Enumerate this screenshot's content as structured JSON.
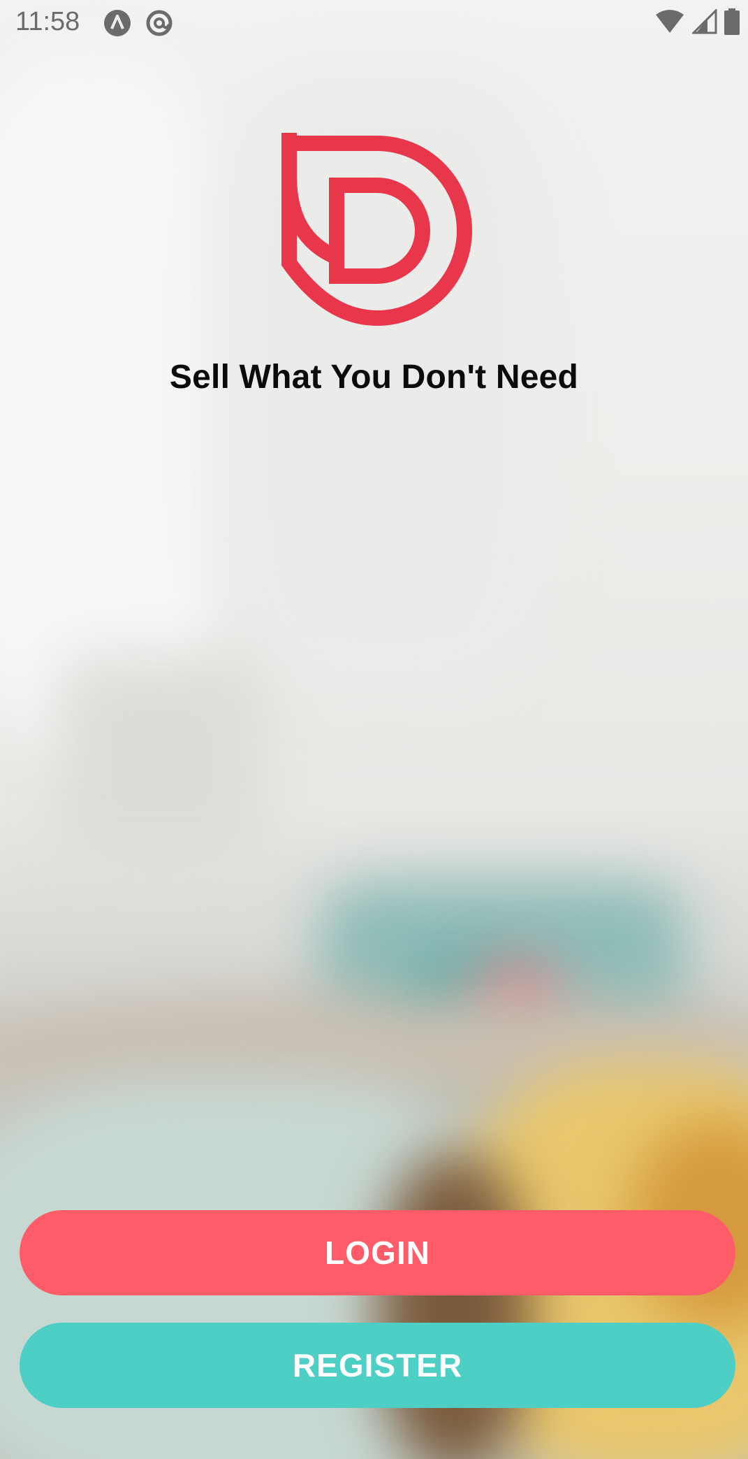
{
  "status_bar": {
    "time": "11:58",
    "icons": [
      "a-circle-icon",
      "at-circle-icon",
      "wifi-icon",
      "signal-icon",
      "battery-icon"
    ]
  },
  "logo": {
    "icon": "d-logo-icon",
    "color": "#e8364a"
  },
  "tagline": "Sell What You Don't Need",
  "buttons": {
    "login_label": "LOGIN",
    "register_label": "REGISTER",
    "login_color": "#fd5c68",
    "register_color": "#4ecfc5"
  }
}
